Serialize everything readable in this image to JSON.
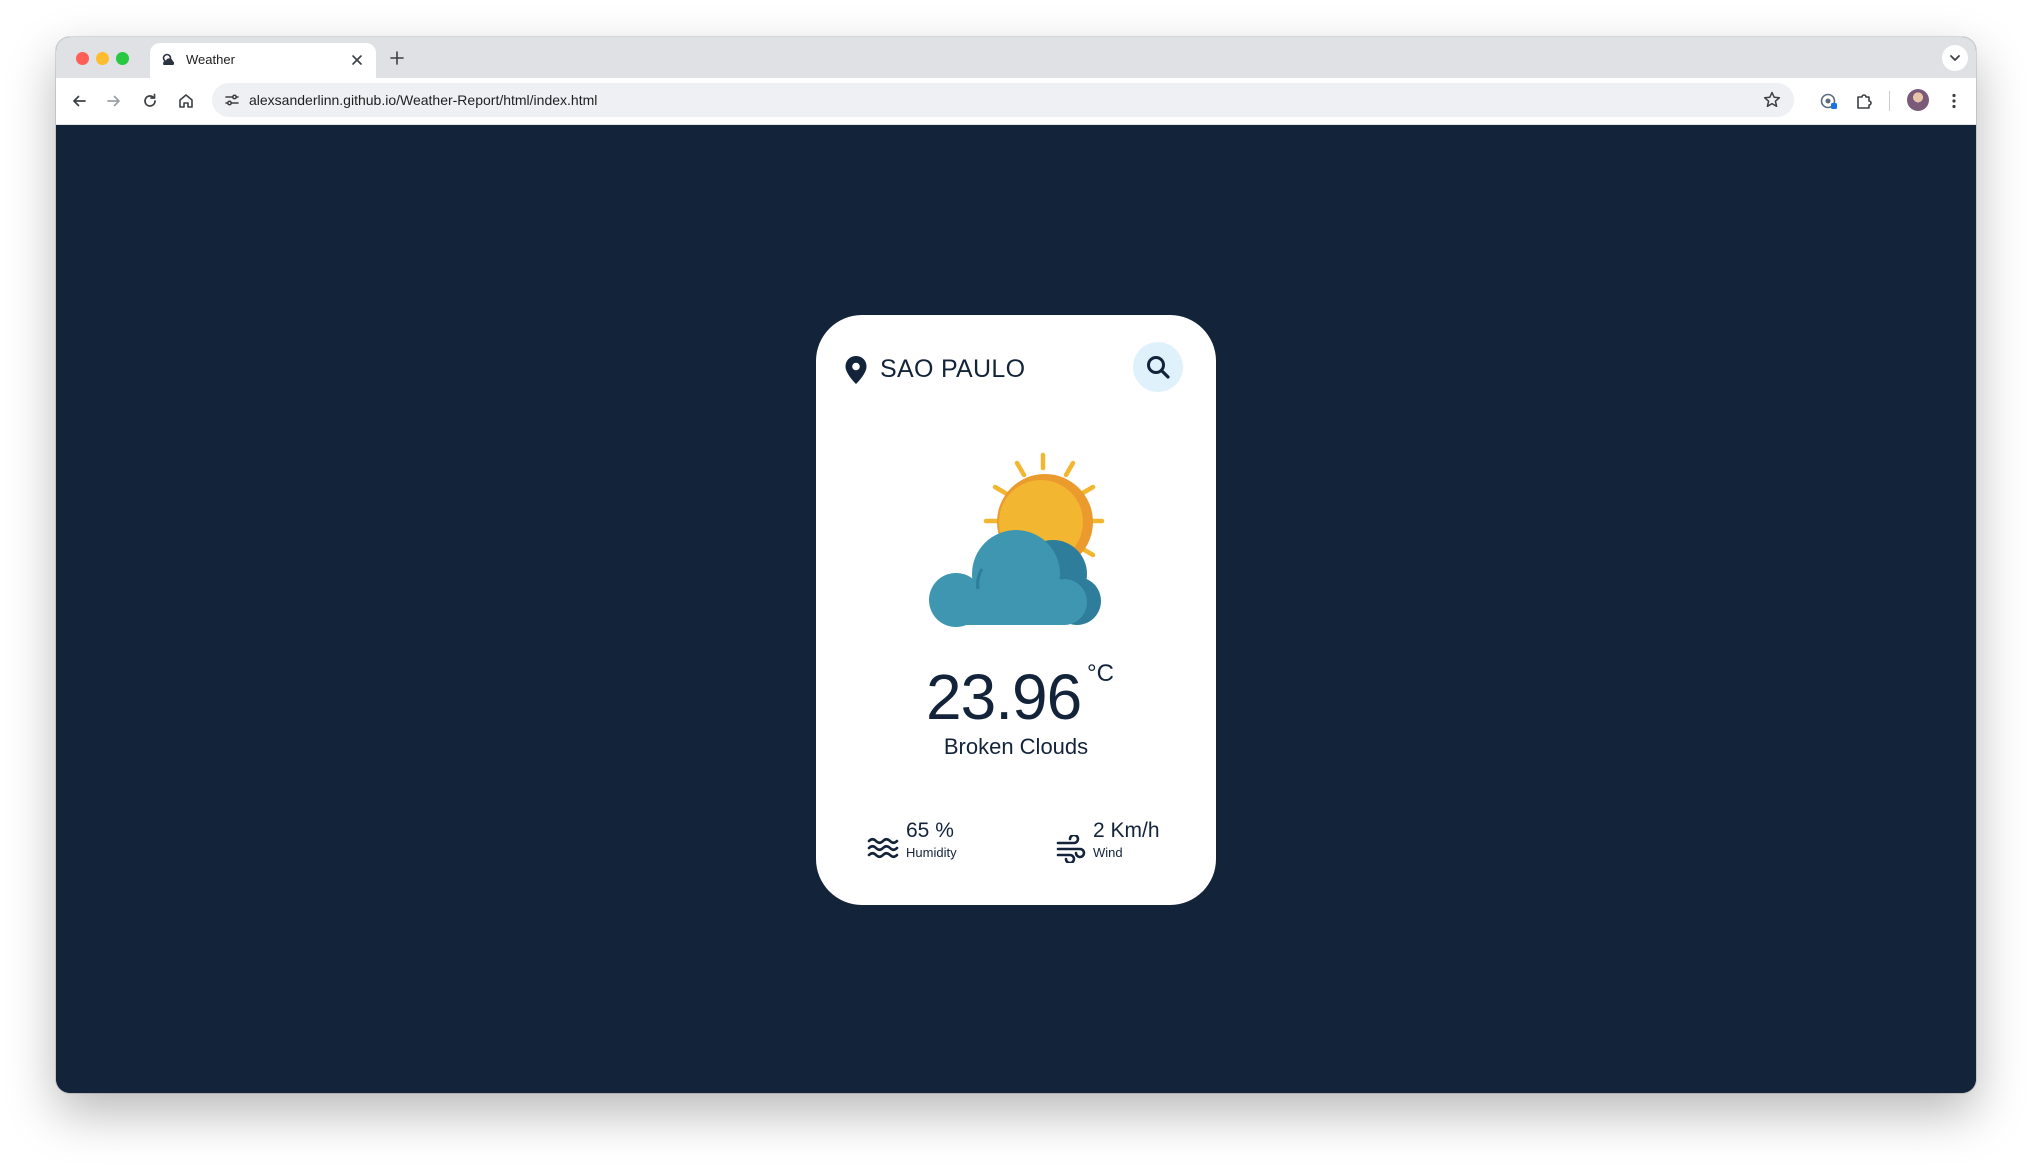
{
  "browser": {
    "tab_title": "Weather",
    "url": "alexsanderlinn.github.io/Weather-Report/html/index.html"
  },
  "weather": {
    "city": "SAO PAULO",
    "temperature": "23.96",
    "unit": "°C",
    "description": "Broken Clouds",
    "humidity_value": "65 %",
    "humidity_label": "Humidity",
    "wind_value": "2 Km/h",
    "wind_label": "Wind"
  },
  "colors": {
    "page_background": "#13243a",
    "card_background": "#ffffff",
    "text": "#13243a",
    "search_button": "#dff1fb",
    "sun": "#f3b630",
    "cloud": "#3e96b1"
  },
  "icons": {
    "location": "map-pin-icon",
    "search": "magnifier-icon",
    "weather": "sun-behind-cloud-icon",
    "humidity": "water-waves-icon",
    "wind": "wind-icon"
  }
}
